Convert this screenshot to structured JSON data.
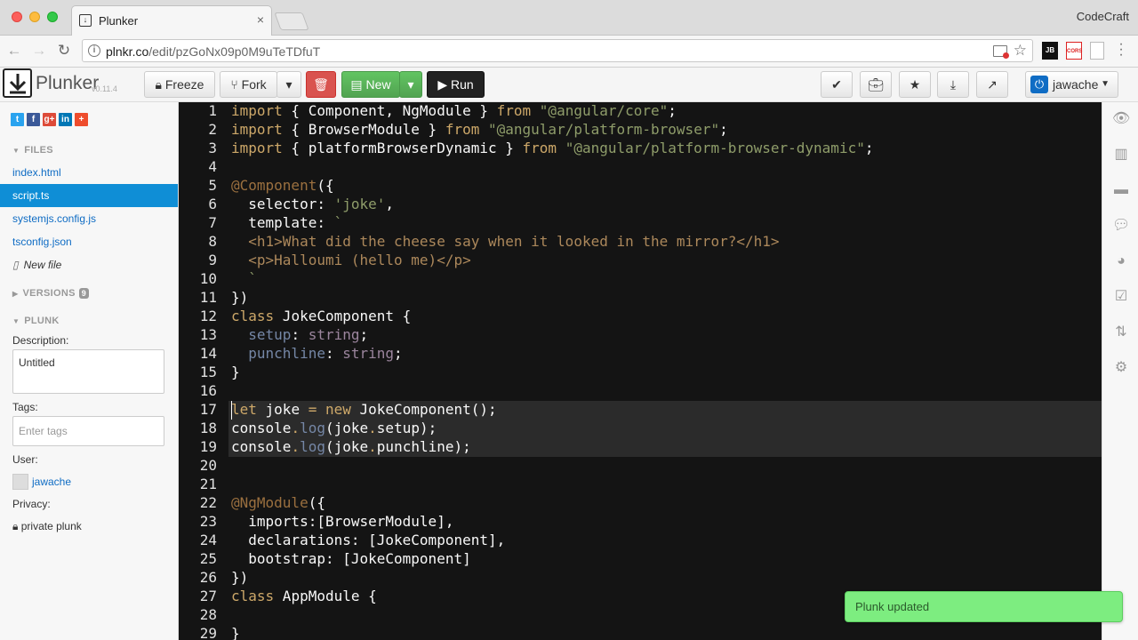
{
  "browser": {
    "tab_title": "Plunker",
    "tab_close": "×",
    "profile_name": "CodeCraft",
    "url_host": "plnkr.co",
    "url_path": "/edit/pzGoNx09p0M9uTeTDfuT",
    "ext_jb": "JB",
    "ext_cors": "CORS"
  },
  "toolbar": {
    "logo_text": "Plunker",
    "logo_version": "v0.11.4",
    "freeze_label": "Freeze",
    "fork_label": "Fork",
    "new_label": "New",
    "run_label": "Run",
    "user_name": "jawache"
  },
  "sidebar": {
    "social": [
      "t",
      "f",
      "g+",
      "in",
      "+"
    ],
    "files_heading": "FILES",
    "files": [
      "index.html",
      "script.ts",
      "systemjs.config.js",
      "tsconfig.json"
    ],
    "active_file": "script.ts",
    "new_file_label": "New file",
    "versions_heading": "VERSIONS",
    "versions_count": "9",
    "plunk_heading": "PLUNK",
    "description_label": "Description:",
    "description_value": "Untitled",
    "tags_label": "Tags:",
    "tags_placeholder": "Enter tags",
    "user_label": "User:",
    "user_value": "jawache",
    "privacy_label": "Privacy:",
    "privacy_value": "private plunk"
  },
  "editor": {
    "first_line_number": 1,
    "highlighted_lines": [
      17,
      18,
      19
    ],
    "cursor_line": 17,
    "lines": [
      "import { Component, NgModule } from \"@angular/core\";",
      "import { BrowserModule } from \"@angular/platform-browser\";",
      "import { platformBrowserDynamic } from \"@angular/platform-browser-dynamic\";",
      "",
      "@Component({",
      "  selector: 'joke',",
      "  template: `",
      "  <h1>What did the cheese say when it looked in the mirror?</h1>",
      "  <p>Halloumi (hello me)</p>",
      "  `",
      "})",
      "class JokeComponent {",
      "  setup: string;",
      "  punchline: string;",
      "}",
      "",
      "let joke = new JokeComponent();",
      "console.log(joke.setup);",
      "console.log(joke.punchline);",
      "",
      "",
      "@NgModule({",
      "  imports:[BrowserModule],",
      "  declarations: [JokeComponent],",
      "  bootstrap: [JokeComponent]",
      "})",
      "class AppModule {",
      "",
      "}"
    ]
  },
  "rail": {
    "icons": [
      "eye-icon",
      "book-icon",
      "briefcase-icon",
      "comments-icon",
      "dashboard-icon",
      "checkbox-icon",
      "retweet-icon",
      "gear-icon"
    ]
  },
  "toast": {
    "message": "Plunk updated"
  },
  "colors": {
    "editor_bg": "#141414",
    "keyword": "#cda869",
    "string": "#8f9d6a",
    "accent_blue": "#0f8ed6",
    "new_green": "#5cb85c",
    "delete_red": "#d9534f",
    "toast_green": "#7ded80"
  }
}
